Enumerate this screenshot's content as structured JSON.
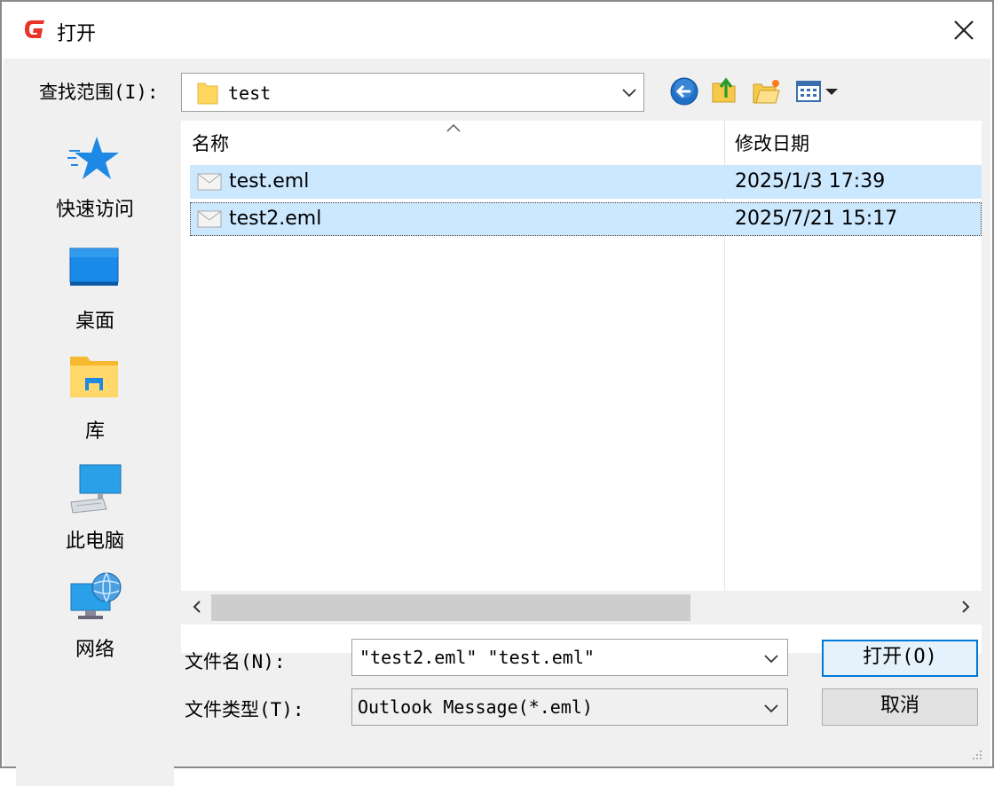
{
  "window": {
    "title": "打开",
    "close_icon": "close-icon",
    "app_icon": "app-logo-icon"
  },
  "lookin": {
    "label": "查找范围(I):",
    "value": "test"
  },
  "toolbar": {
    "icons": [
      "back-icon",
      "up-folder-icon",
      "new-folder-icon",
      "view-menu-icon"
    ]
  },
  "places": [
    {
      "label": "快速访问",
      "icon": "star-icon"
    },
    {
      "label": "桌面",
      "icon": "desktop-icon"
    },
    {
      "label": "库",
      "icon": "library-icon"
    },
    {
      "label": "此电脑",
      "icon": "computer-icon"
    },
    {
      "label": "网络",
      "icon": "network-icon"
    }
  ],
  "columns": {
    "name": "名称",
    "date": "修改日期"
  },
  "files": [
    {
      "name": "test.eml",
      "date": "2025/1/3 17:39",
      "selected": true,
      "focused": false
    },
    {
      "name": "test2.eml",
      "date": "2025/7/21 15:17",
      "selected": true,
      "focused": true
    }
  ],
  "filename": {
    "label": "文件名(N):",
    "value": "\"test2.eml\" \"test.eml\""
  },
  "filetype": {
    "label": "文件类型(T):",
    "value": "Outlook Message(*.eml)"
  },
  "buttons": {
    "open": "打开(O)",
    "cancel": "取消"
  },
  "colors": {
    "selection": "#cce8ff",
    "accent": "#0078d7",
    "app_red": "#e8322a"
  }
}
